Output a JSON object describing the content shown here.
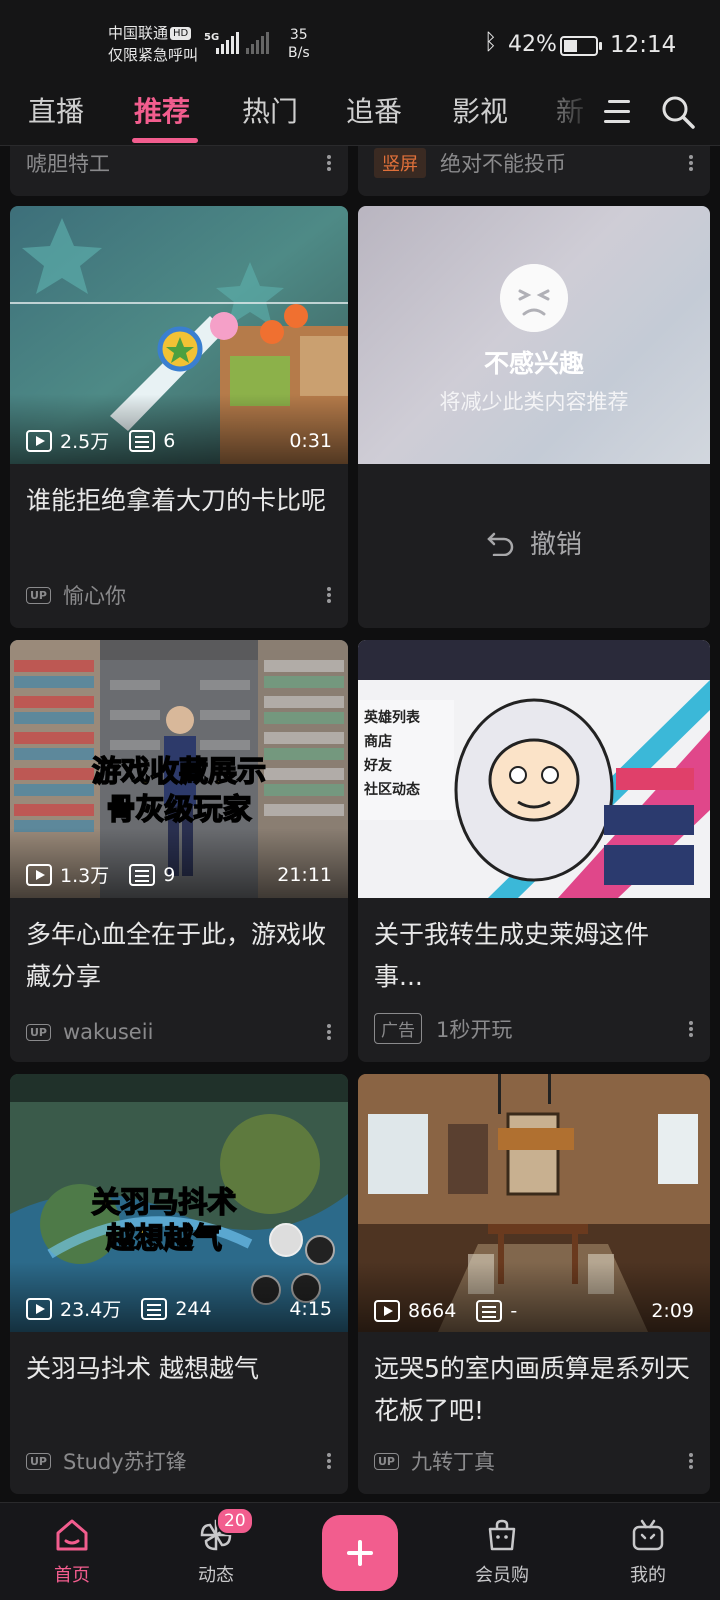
{
  "status_bar": {
    "carrier": "中国联通",
    "hd_badge": "HD",
    "emergency": "仅限紧急呼叫",
    "network": "5G",
    "speed_value": "35",
    "speed_unit": "B/s",
    "battery": "42%",
    "battery_level": 0.42,
    "time": "12:14"
  },
  "nav": {
    "tabs": [
      "直播",
      "推荐",
      "热门",
      "追番",
      "影视",
      "新"
    ],
    "active_tab": "推荐"
  },
  "partial_cards": [
    {
      "author": "唬胆特工"
    },
    {
      "tag": "竖屏",
      "author": "绝对不能投币"
    }
  ],
  "cards": [
    {
      "views": "2.5万",
      "danmaku": "6",
      "duration": "0:31",
      "title": "谁能拒绝拿着大刀的卡比呢",
      "author_tag": "UP",
      "author": "愉心你"
    },
    {
      "views": "1.3万",
      "danmaku": "9",
      "duration": "21:11",
      "title": "多年心血全在于此，游戏收藏分享",
      "author_tag": "UP",
      "author": "wakuseii",
      "overlay_line1": "游戏收藏展示",
      "overlay_line2": "骨灰级玩家"
    },
    {
      "title": "关于我转生成史莱姆这件事...",
      "author_tag": "广告",
      "author": "1秒开玩"
    },
    {
      "views": "23.4万",
      "danmaku": "244",
      "duration": "4:15",
      "title": "关羽马抖术 越想越气",
      "author_tag": "UP",
      "author": "Study苏打锋",
      "overlay_line1": "关羽马抖术",
      "overlay_line2": "越想越气"
    },
    {
      "views": "8664",
      "danmaku": "-",
      "duration": "2:09",
      "title": "远哭5的室内画质算是系列天花板了吧!",
      "author_tag": "UP",
      "author": "九转丁真"
    }
  ],
  "dismiss_card": {
    "title": "不感兴趣",
    "subtitle": "将减少此类内容推荐",
    "undo_label": "撤销"
  },
  "bottom_nav": {
    "home": "首页",
    "dynamic": "动态",
    "dynamic_badge": "20",
    "vip": "会员购",
    "mine": "我的"
  },
  "colors": {
    "accent": "#f25d8e",
    "background": "#0f0f10",
    "card": "#1e1e20"
  }
}
